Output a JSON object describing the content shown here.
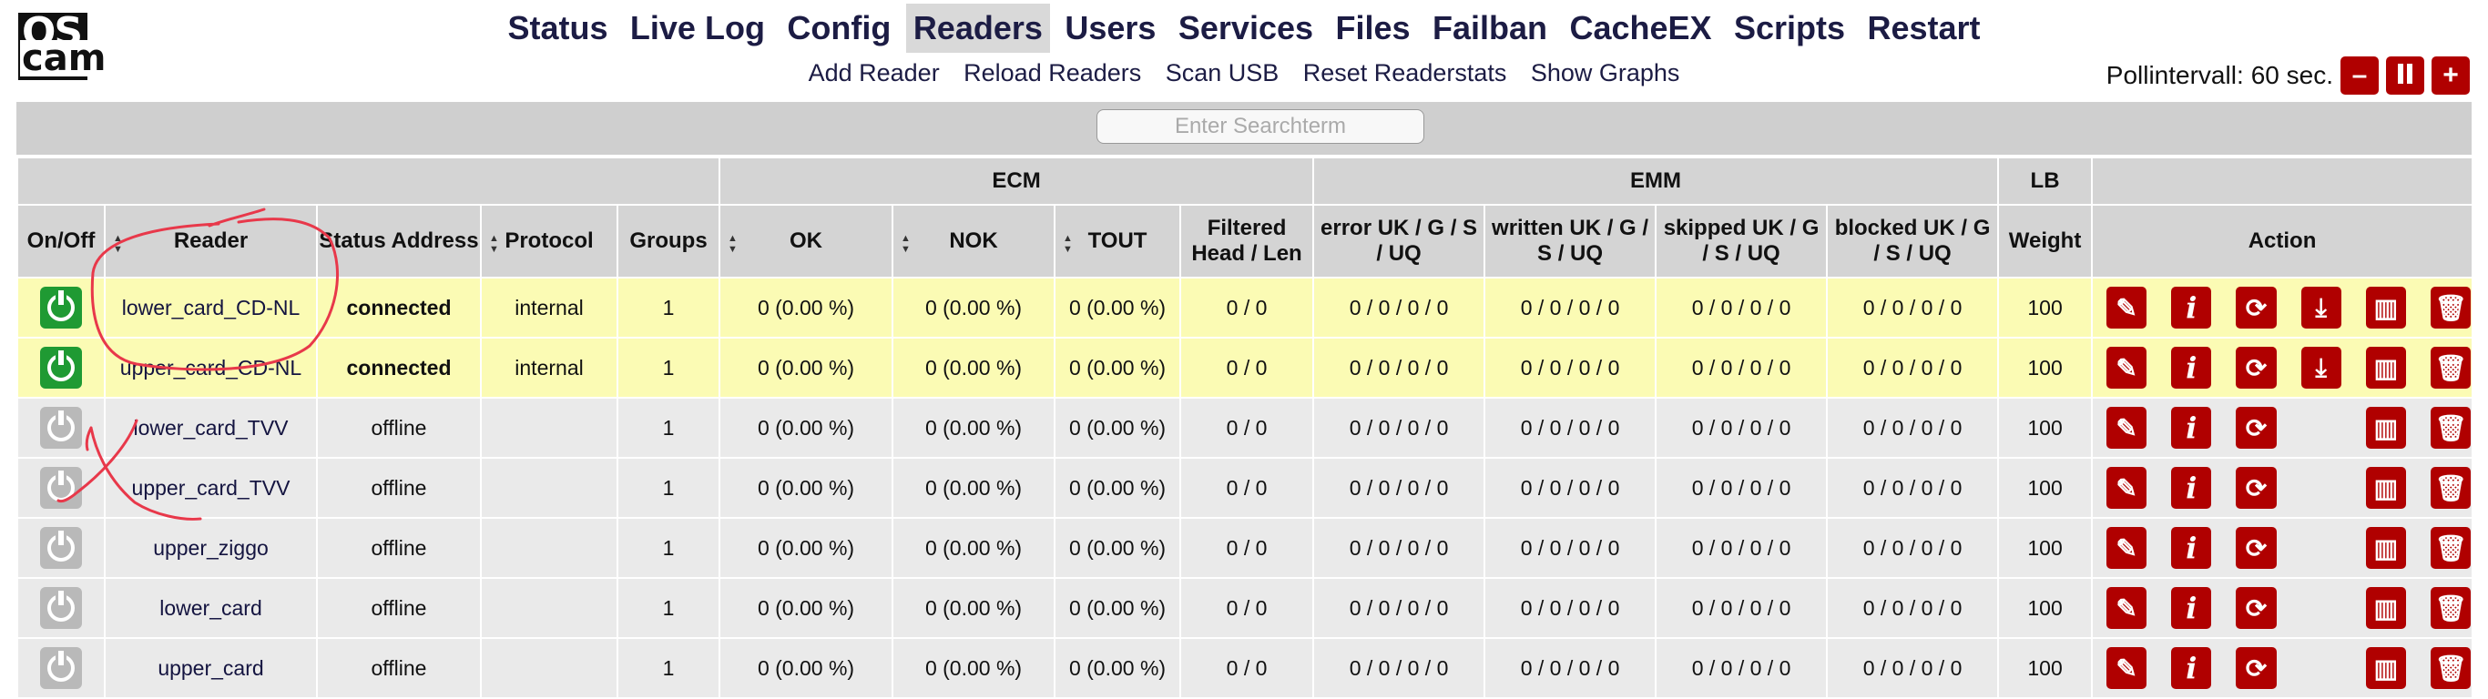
{
  "logo": {
    "line1": "OS",
    "line2": "cam"
  },
  "nav": {
    "items": [
      "Status",
      "Live Log",
      "Config",
      "Readers",
      "Users",
      "Services",
      "Files",
      "Failban",
      "CacheEX",
      "Scripts",
      "Restart"
    ],
    "active": "Readers"
  },
  "subnav": {
    "items": [
      "Add Reader",
      "Reload Readers",
      "Scan USB",
      "Reset Readerstats",
      "Show Graphs"
    ]
  },
  "poll": {
    "label": "Pollintervall:",
    "value": "60 sec.",
    "minus": "–",
    "plus": "+"
  },
  "search": {
    "placeholder": "Enter Searchterm",
    "value": ""
  },
  "table": {
    "group_headers": {
      "ecm": "ECM",
      "emm": "EMM",
      "lb": "LB"
    },
    "headers": {
      "onoff": "On/Off",
      "reader": "Reader",
      "status": "Status Address",
      "protocol": "Protocol",
      "groups": "Groups",
      "ok": "OK",
      "nok": "NOK",
      "tout": "TOUT",
      "filtered": "Filtered Head / Len",
      "error": "error UK / G / S / UQ",
      "written": "written UK / G / S / UQ",
      "skipped": "skipped UK / G / S / UQ",
      "blocked": "blocked UK / G / S / UQ",
      "weight": "Weight",
      "action": "Action"
    },
    "rows": [
      {
        "enabled": true,
        "reader": "lower_card_CD-NL",
        "status": "connected",
        "protocol": "internal",
        "groups": "1",
        "ok": "0 (0.00 %)",
        "nok": "0 (0.00 %)",
        "tout": "0 (0.00 %)",
        "filtered": "0 / 0",
        "error": "0 / 0 / 0 / 0",
        "written": "0 / 0 / 0 / 0",
        "skipped": "0 / 0 / 0 / 0",
        "blocked": "0 / 0 / 0 / 0",
        "weight": "100",
        "download": true
      },
      {
        "enabled": true,
        "reader": "upper_card_CD-NL",
        "status": "connected",
        "protocol": "internal",
        "groups": "1",
        "ok": "0 (0.00 %)",
        "nok": "0 (0.00 %)",
        "tout": "0 (0.00 %)",
        "filtered": "0 / 0",
        "error": "0 / 0 / 0 / 0",
        "written": "0 / 0 / 0 / 0",
        "skipped": "0 / 0 / 0 / 0",
        "blocked": "0 / 0 / 0 / 0",
        "weight": "100",
        "download": true
      },
      {
        "enabled": false,
        "reader": "lower_card_TVV",
        "status": "offline",
        "protocol": "",
        "groups": "1",
        "ok": "0 (0.00 %)",
        "nok": "0 (0.00 %)",
        "tout": "0 (0.00 %)",
        "filtered": "0 / 0",
        "error": "0 / 0 / 0 / 0",
        "written": "0 / 0 / 0 / 0",
        "skipped": "0 / 0 / 0 / 0",
        "blocked": "0 / 0 / 0 / 0",
        "weight": "100",
        "download": false
      },
      {
        "enabled": false,
        "reader": "upper_card_TVV",
        "status": "offline",
        "protocol": "",
        "groups": "1",
        "ok": "0 (0.00 %)",
        "nok": "0 (0.00 %)",
        "tout": "0 (0.00 %)",
        "filtered": "0 / 0",
        "error": "0 / 0 / 0 / 0",
        "written": "0 / 0 / 0 / 0",
        "skipped": "0 / 0 / 0 / 0",
        "blocked": "0 / 0 / 0 / 0",
        "weight": "100",
        "download": false
      },
      {
        "enabled": false,
        "reader": "upper_ziggo",
        "status": "offline",
        "protocol": "",
        "groups": "1",
        "ok": "0 (0.00 %)",
        "nok": "0 (0.00 %)",
        "tout": "0 (0.00 %)",
        "filtered": "0 / 0",
        "error": "0 / 0 / 0 / 0",
        "written": "0 / 0 / 0 / 0",
        "skipped": "0 / 0 / 0 / 0",
        "blocked": "0 / 0 / 0 / 0",
        "weight": "100",
        "download": false
      },
      {
        "enabled": false,
        "reader": "lower_card",
        "status": "offline",
        "protocol": "",
        "groups": "1",
        "ok": "0 (0.00 %)",
        "nok": "0 (0.00 %)",
        "tout": "0 (0.00 %)",
        "filtered": "0 / 0",
        "error": "0 / 0 / 0 / 0",
        "written": "0 / 0 / 0 / 0",
        "skipped": "0 / 0 / 0 / 0",
        "blocked": "0 / 0 / 0 / 0",
        "weight": "100",
        "download": false
      },
      {
        "enabled": false,
        "reader": "upper_card",
        "status": "offline",
        "protocol": "",
        "groups": "1",
        "ok": "0 (0.00 %)",
        "nok": "0 (0.00 %)",
        "tout": "0 (0.00 %)",
        "filtered": "0 / 0",
        "error": "0 / 0 / 0 / 0",
        "written": "0 / 0 / 0 / 0",
        "skipped": "0 / 0 / 0 / 0",
        "blocked": "0 / 0 / 0 / 0",
        "weight": "100",
        "download": false
      }
    ],
    "action_icons": [
      "edit-icon",
      "info-icon",
      "refresh-icon",
      "download-icon",
      "stats-icon",
      "delete-icon"
    ]
  },
  "colors": {
    "action_red": "#b00000",
    "connected_row": "#fbfbb4",
    "offline_row": "#eaeaea",
    "power_on": "#1f9a33",
    "power_off": "#b9b9b9",
    "header_gray": "#d4d4d4",
    "annotation_red": "#e8384a"
  }
}
